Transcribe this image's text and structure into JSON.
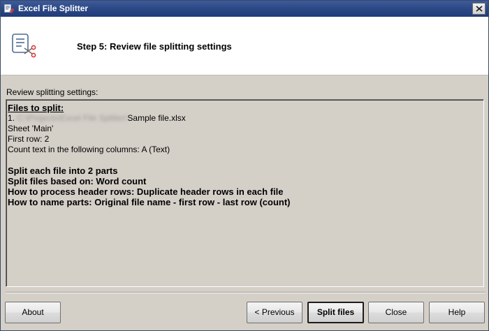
{
  "window": {
    "title": "Excel File Splitter",
    "icon": "app-icon",
    "close_icon": "close-icon"
  },
  "header": {
    "title": "Step 5: Review file splitting settings",
    "icon": "file-scissors-icon"
  },
  "review": {
    "label": "Review splitting settings:",
    "files_heading": "Files to split:",
    "file_index": "1.",
    "file_path_blurred": "C:\\Projects\\Excel File Splitter\\",
    "file_name": "Sample file.xlsx",
    "sheet": "Sheet 'Main'",
    "first_row": "First row: 2",
    "count_columns": "Count text in the following columns: A (Text)",
    "split_parts": "Split each file into 2 parts",
    "split_basis": "Split files based on: Word count",
    "header_rows": "How to process header rows: Duplicate header rows in each file",
    "naming": "How to name parts: Original file name - first row - last row (count)"
  },
  "buttons": {
    "about": "About",
    "previous": "< Previous",
    "split": "Split files",
    "close": "Close",
    "help": "Help"
  },
  "colors": {
    "titlebar": "#2d4a87",
    "dialog_bg": "#d4d0c8",
    "header_bg": "#ffffff",
    "icon_accent": "#d93a3a"
  }
}
